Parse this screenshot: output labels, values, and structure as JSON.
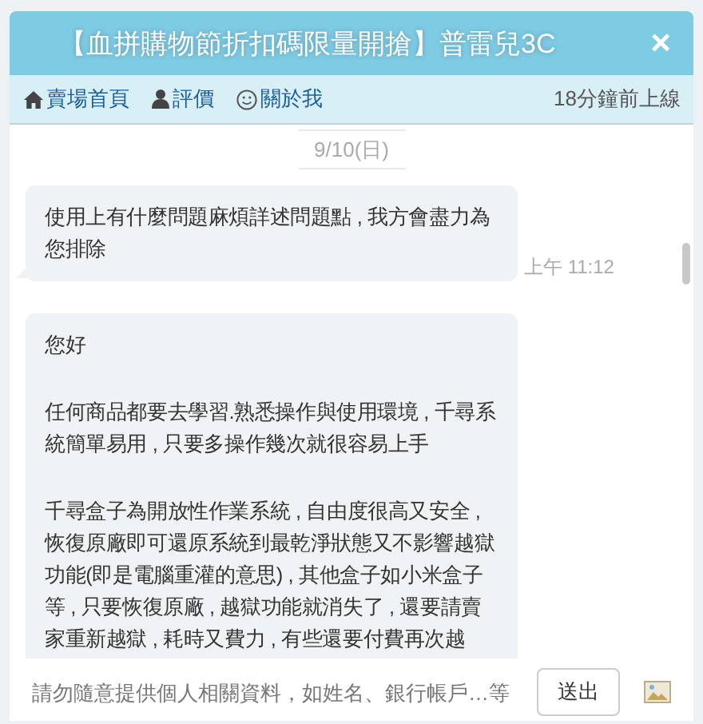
{
  "header": {
    "title": "【血拼購物節折扣碼限量開搶】普雷兒3C",
    "close": "×"
  },
  "nav": {
    "links": [
      {
        "label": "賣場首頁"
      },
      {
        "label": "評價"
      },
      {
        "label": "關於我"
      }
    ],
    "status": "18分鐘前上線"
  },
  "date": "9/10(日)",
  "messages": [
    {
      "paragraphs": [
        "使用上有什麼問題麻煩詳述問題點 , 我方會盡力為您排除"
      ],
      "time": "上午 11:12"
    },
    {
      "paragraphs": [
        "您好",
        "任何商品都要去學習.熟悉操作與使用環境 , 千尋系統簡單易用 , 只要多操作幾次就很容易上手",
        "千尋盒子為開放性作業系統 , 自由度很高又安全 , 恢復原廠即可還原系統到最乾淨狀態又不影響越獄功能(即是電腦重灌的意思) , 其他盒子如小米盒子等 , 只要恢復原廠 , 越獄功能就消失了 , 還要請賣家重新越獄 , 耗時又費力 , 有些還要付費再次越"
      ]
    }
  ],
  "composer": {
    "placeholder": "請勿隨意提供個人相關資料，如姓名、銀行帳戶…等",
    "send": "送出"
  }
}
